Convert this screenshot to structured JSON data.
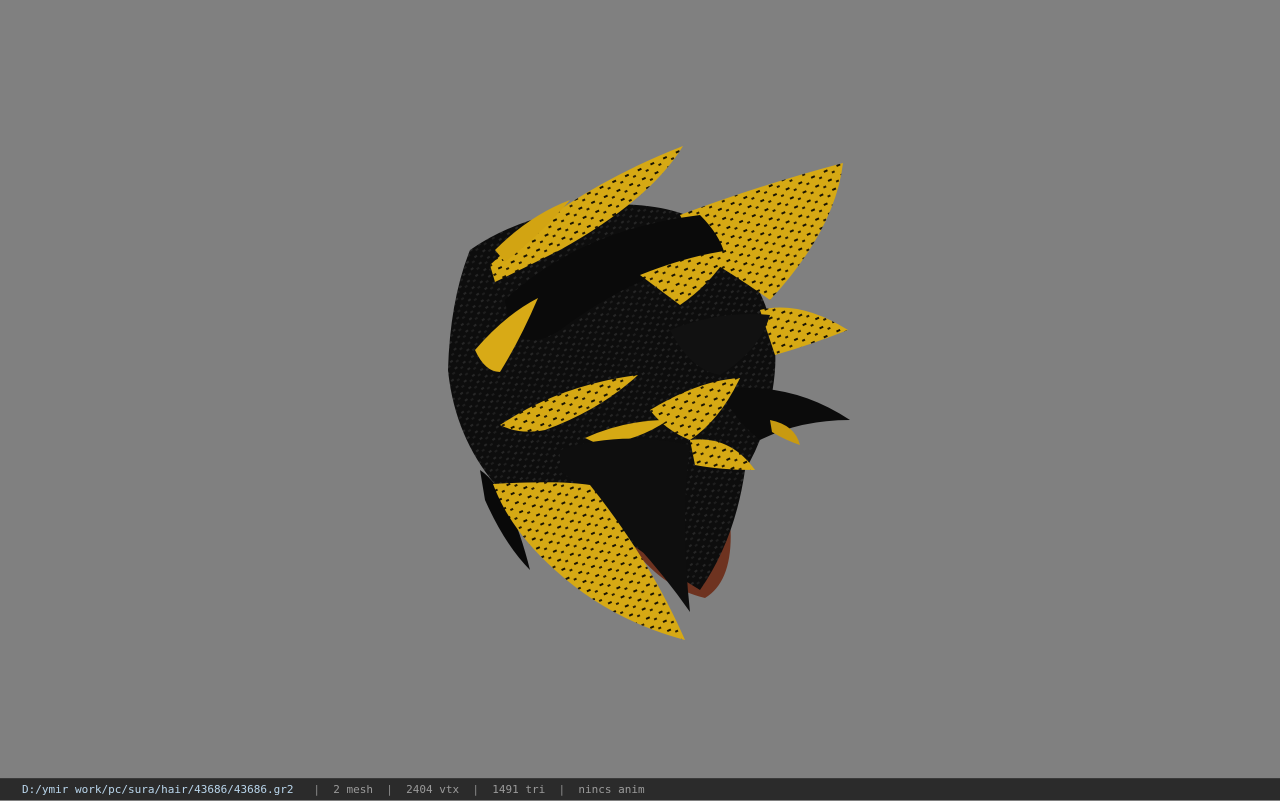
{
  "viewport": {
    "background_color": "#808080",
    "model": {
      "name": "hair-model",
      "colors": {
        "gold": "#d9ac14",
        "gold_dark": "#a8820a",
        "black": "#0c0c0c",
        "black_sheen": "#2a2a2a",
        "skin": "#7a3a22"
      }
    }
  },
  "status_bar": {
    "file_path": "D:/ymir work/pc/sura/hair/43686/43686.gr2",
    "separator": "|",
    "mesh_count": "2 mesh",
    "vertex_count": "2404 vtx",
    "triangle_count": "1491 tri",
    "anim_status": "nincs anim"
  }
}
